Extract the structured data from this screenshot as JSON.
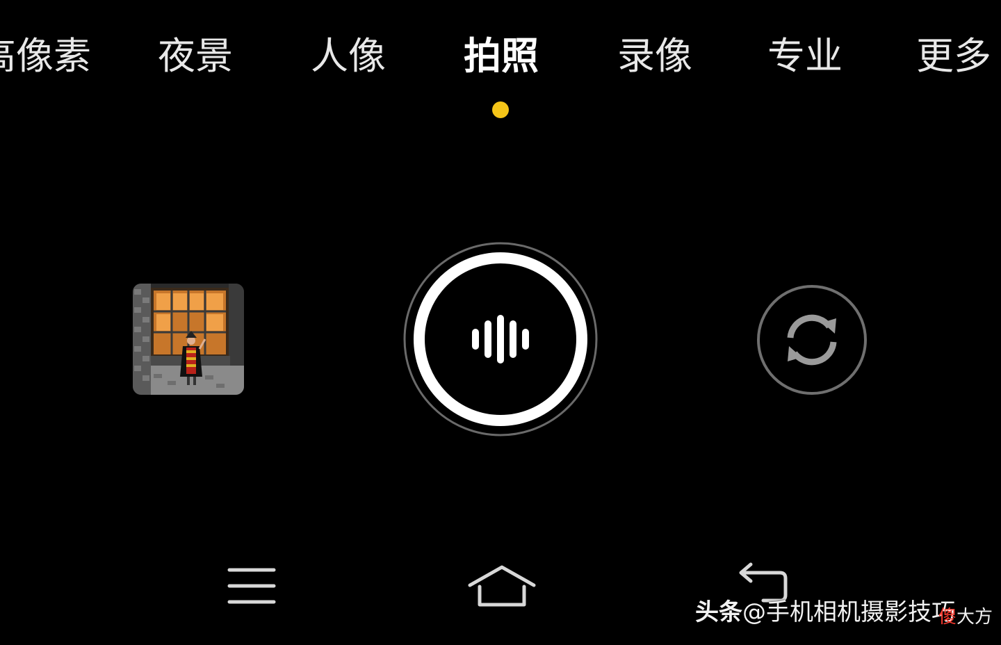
{
  "modes": [
    {
      "label": "高像素",
      "active": false
    },
    {
      "label": "夜景",
      "active": false
    },
    {
      "label": "人像",
      "active": false
    },
    {
      "label": "拍照",
      "active": true
    },
    {
      "label": "录像",
      "active": false
    },
    {
      "label": "专业",
      "active": false
    },
    {
      "label": "更多",
      "active": false
    }
  ],
  "colors": {
    "background": "#000000",
    "active_indicator": "#f5c518",
    "text": "#ffffff"
  },
  "controls": {
    "gallery_thumbnail": "gallery-thumbnail",
    "shutter_icon": "voice-wave-icon",
    "switch_camera_icon": "camera-switch-icon"
  },
  "nav": {
    "menu_icon": "menu-icon",
    "home_icon": "home-icon",
    "back_icon": "back-icon"
  },
  "watermark": {
    "brand": "头条",
    "handle": "@手机相机摄影技巧",
    "badge_1": "傻",
    "badge_2": "大方"
  }
}
